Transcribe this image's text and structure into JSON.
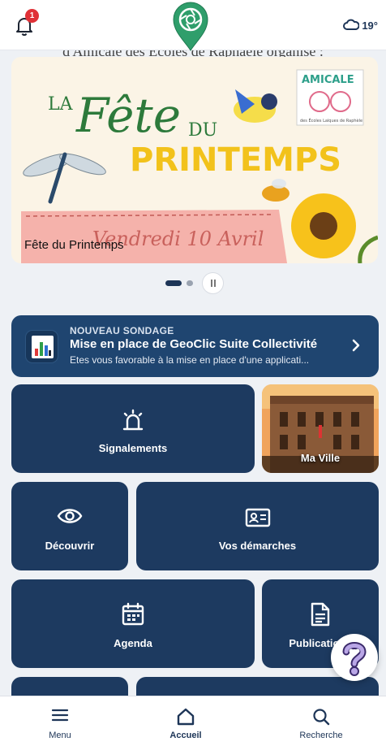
{
  "header": {
    "notification_count": "1",
    "temperature": "19°",
    "icons": {
      "notifications": "bell-icon",
      "weather": "cloud-icon",
      "logo": "camera-pin-logo"
    }
  },
  "carousel": {
    "peek_text": "d'Amicale des Écoles de Raphaële organise :",
    "caption": "Fête du Printemps",
    "poster": {
      "title_la": "LA",
      "title_fete": "Fête",
      "title_du": "DU",
      "title_printemps": "PRINTEMPS",
      "logo_name": "AMICALE",
      "logo_sub": "des Écoles Laïques de Raphèle",
      "date": "Vendredi 10 Avril"
    },
    "active_slide": 1,
    "total_slides": 2
  },
  "survey": {
    "kicker": "NOUVEAU SONDAGE",
    "title": "Mise en place de GeoClic Suite Collectivité",
    "subtitle": "Etes vous favorable à la mise en place d'une applicati..."
  },
  "tiles": {
    "signalements": "Signalements",
    "ma_ville": "Ma Ville",
    "decouvrir": "Découvrir",
    "demarches": "Vos démarches",
    "agenda": "Agenda",
    "publications": "Publications"
  },
  "nav": {
    "menu": "Menu",
    "accueil": "Accueil",
    "recherche": "Recherche",
    "active": "accueil"
  },
  "colors": {
    "tile": "#1d3a60",
    "survey": "#1f4570",
    "accent_green": "#2f9e6b",
    "badge": "#e03137"
  }
}
